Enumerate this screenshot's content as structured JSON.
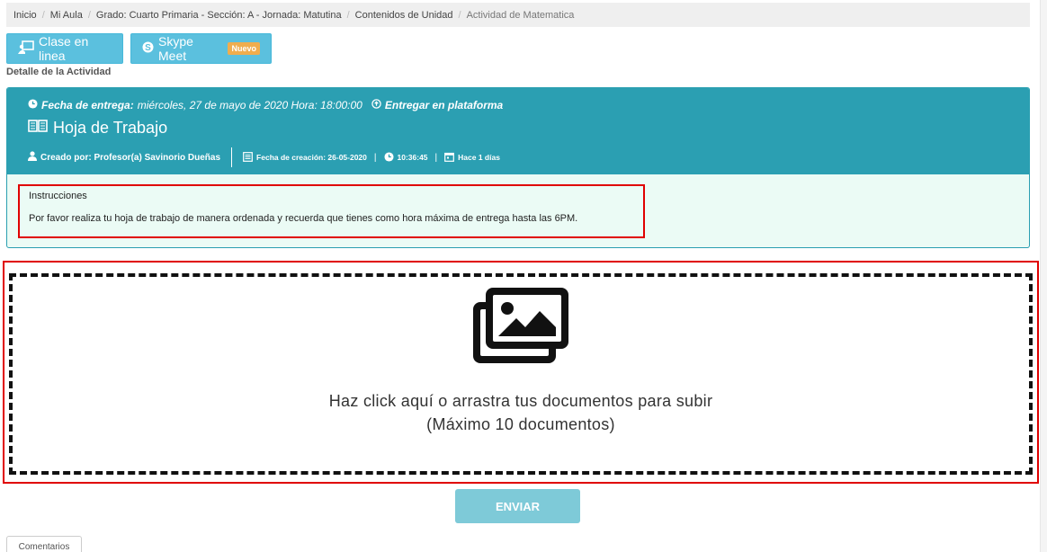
{
  "breadcrumb": [
    {
      "label": "Inicio"
    },
    {
      "label": "Mi Aula"
    },
    {
      "label": "Grado: Cuarto Primaria - Sección: A - Jornada: Matutina"
    },
    {
      "label": "Contenidos de Unidad"
    },
    {
      "label": "Actividad de Matematica"
    }
  ],
  "buttons": {
    "online_class": "Clase en linea",
    "skype": "Skype Meet",
    "skype_badge": "Nuevo"
  },
  "detail_label": "Detalle de la Actividad",
  "activity": {
    "due_label": "Fecha de entrega:",
    "due_value": "miércoles, 27 de mayo de 2020 Hora: 18:00:00",
    "submit_mode": "Entregar en plataforma",
    "title": "Hoja de Trabajo",
    "created_by": "Creado por: Profesor(a) Savinorio Dueñas",
    "created_date": "Fecha de creación: 26-05-2020",
    "created_time": "10:36:45",
    "age": "Hace 1 días"
  },
  "instructions": {
    "title": "Instrucciones",
    "text": "Por favor realiza tu hoja de trabajo de manera ordenada y recuerda que tienes como hora máxima de entrega hasta las 6PM."
  },
  "upload": {
    "icon": "images-icon",
    "text": "Haz click aquí o arrastra tus documentos para subir (Máximo 10 documentos)"
  },
  "send_button": "ENVIAR",
  "tabs": {
    "comments": "Comentarios"
  },
  "colors": {
    "header": "#2b9fb2",
    "instructions_bg": "#ebfbf5",
    "button": "#5bc0de",
    "send_disabled": "#7ecad8",
    "highlight": "#e00000"
  }
}
